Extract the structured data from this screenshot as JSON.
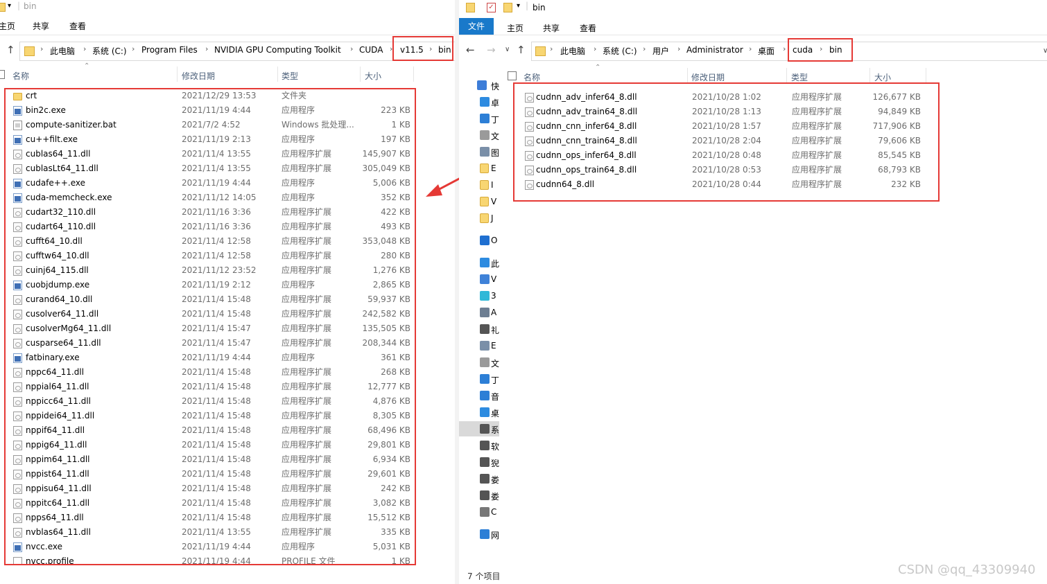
{
  "left": {
    "title": "bin",
    "ribbon": [
      "主页",
      "共享",
      "查看"
    ],
    "breadcrumb": [
      "此电脑",
      "系统 (C:)",
      "Program Files",
      "NVIDIA GPU Computing Toolkit",
      "CUDA",
      "v11.5",
      "bin"
    ],
    "columns": {
      "name": "名称",
      "date": "修改日期",
      "type": "类型",
      "size": "大小"
    },
    "files": [
      {
        "name": "crt",
        "date": "2021/12/29 13:53",
        "type": "文件夹",
        "size": "",
        "icon": "folder-icon"
      },
      {
        "name": "bin2c.exe",
        "date": "2021/11/19 4:44",
        "type": "应用程序",
        "size": "223 KB",
        "icon": "exe-icon"
      },
      {
        "name": "compute-sanitizer.bat",
        "date": "2021/7/2 4:52",
        "type": "Windows 批处理...",
        "size": "1 KB",
        "icon": "bat-icon"
      },
      {
        "name": "cu++filt.exe",
        "date": "2021/11/19 2:13",
        "type": "应用程序",
        "size": "197 KB",
        "icon": "exe-icon"
      },
      {
        "name": "cublas64_11.dll",
        "date": "2021/11/4 13:55",
        "type": "应用程序扩展",
        "size": "145,907 KB",
        "icon": "dll-icon"
      },
      {
        "name": "cublasLt64_11.dll",
        "date": "2021/11/4 13:55",
        "type": "应用程序扩展",
        "size": "305,049 KB",
        "icon": "dll-icon"
      },
      {
        "name": "cudafe++.exe",
        "date": "2021/11/19 4:44",
        "type": "应用程序",
        "size": "5,006 KB",
        "icon": "exe-icon"
      },
      {
        "name": "cuda-memcheck.exe",
        "date": "2021/11/12 14:05",
        "type": "应用程序",
        "size": "352 KB",
        "icon": "exe-icon"
      },
      {
        "name": "cudart32_110.dll",
        "date": "2021/11/16 3:36",
        "type": "应用程序扩展",
        "size": "422 KB",
        "icon": "dll-icon"
      },
      {
        "name": "cudart64_110.dll",
        "date": "2021/11/16 3:36",
        "type": "应用程序扩展",
        "size": "493 KB",
        "icon": "dll-icon"
      },
      {
        "name": "cufft64_10.dll",
        "date": "2021/11/4 12:58",
        "type": "应用程序扩展",
        "size": "353,048 KB",
        "icon": "dll-icon"
      },
      {
        "name": "cufftw64_10.dll",
        "date": "2021/11/4 12:58",
        "type": "应用程序扩展",
        "size": "280 KB",
        "icon": "dll-icon"
      },
      {
        "name": "cuinj64_115.dll",
        "date": "2021/11/12 23:52",
        "type": "应用程序扩展",
        "size": "1,276 KB",
        "icon": "dll-icon"
      },
      {
        "name": "cuobjdump.exe",
        "date": "2021/11/19 2:12",
        "type": "应用程序",
        "size": "2,865 KB",
        "icon": "exe-icon"
      },
      {
        "name": "curand64_10.dll",
        "date": "2021/11/4 15:48",
        "type": "应用程序扩展",
        "size": "59,937 KB",
        "icon": "dll-icon"
      },
      {
        "name": "cusolver64_11.dll",
        "date": "2021/11/4 15:48",
        "type": "应用程序扩展",
        "size": "242,582 KB",
        "icon": "dll-icon"
      },
      {
        "name": "cusolverMg64_11.dll",
        "date": "2021/11/4 15:47",
        "type": "应用程序扩展",
        "size": "135,505 KB",
        "icon": "dll-icon"
      },
      {
        "name": "cusparse64_11.dll",
        "date": "2021/11/4 15:47",
        "type": "应用程序扩展",
        "size": "208,344 KB",
        "icon": "dll-icon"
      },
      {
        "name": "fatbinary.exe",
        "date": "2021/11/19 4:44",
        "type": "应用程序",
        "size": "361 KB",
        "icon": "exe-icon"
      },
      {
        "name": "nppc64_11.dll",
        "date": "2021/11/4 15:48",
        "type": "应用程序扩展",
        "size": "268 KB",
        "icon": "dll-icon"
      },
      {
        "name": "nppial64_11.dll",
        "date": "2021/11/4 15:48",
        "type": "应用程序扩展",
        "size": "12,777 KB",
        "icon": "dll-icon"
      },
      {
        "name": "nppicc64_11.dll",
        "date": "2021/11/4 15:48",
        "type": "应用程序扩展",
        "size": "4,876 KB",
        "icon": "dll-icon"
      },
      {
        "name": "nppidei64_11.dll",
        "date": "2021/11/4 15:48",
        "type": "应用程序扩展",
        "size": "8,305 KB",
        "icon": "dll-icon"
      },
      {
        "name": "nppif64_11.dll",
        "date": "2021/11/4 15:48",
        "type": "应用程序扩展",
        "size": "68,496 KB",
        "icon": "dll-icon"
      },
      {
        "name": "nppig64_11.dll",
        "date": "2021/11/4 15:48",
        "type": "应用程序扩展",
        "size": "29,801 KB",
        "icon": "dll-icon"
      },
      {
        "name": "nppim64_11.dll",
        "date": "2021/11/4 15:48",
        "type": "应用程序扩展",
        "size": "6,934 KB",
        "icon": "dll-icon"
      },
      {
        "name": "nppist64_11.dll",
        "date": "2021/11/4 15:48",
        "type": "应用程序扩展",
        "size": "29,601 KB",
        "icon": "dll-icon"
      },
      {
        "name": "nppisu64_11.dll",
        "date": "2021/11/4 15:48",
        "type": "应用程序扩展",
        "size": "242 KB",
        "icon": "dll-icon"
      },
      {
        "name": "nppitc64_11.dll",
        "date": "2021/11/4 15:48",
        "type": "应用程序扩展",
        "size": "3,082 KB",
        "icon": "dll-icon"
      },
      {
        "name": "npps64_11.dll",
        "date": "2021/11/4 15:48",
        "type": "应用程序扩展",
        "size": "15,512 KB",
        "icon": "dll-icon"
      },
      {
        "name": "nvblas64_11.dll",
        "date": "2021/11/4 13:55",
        "type": "应用程序扩展",
        "size": "335 KB",
        "icon": "dll-icon"
      },
      {
        "name": "nvcc.exe",
        "date": "2021/11/19 4:44",
        "type": "应用程序",
        "size": "5,031 KB",
        "icon": "exe-icon"
      },
      {
        "name": "nvcc.profile",
        "date": "2021/11/19 4:44",
        "type": "PROFILE 文件",
        "size": "1 KB",
        "icon": "file-icon"
      }
    ]
  },
  "right": {
    "title": "bin",
    "ribbon": {
      "file": "文件",
      "home": "主页",
      "share": "共享",
      "view": "查看"
    },
    "breadcrumb": [
      "此电脑",
      "系统 (C:)",
      "用户",
      "Administrator",
      "桌面",
      "cuda",
      "bin"
    ],
    "columns": {
      "name": "名称",
      "date": "修改日期",
      "type": "类型",
      "size": "大小"
    },
    "files": [
      {
        "name": "cudnn_adv_infer64_8.dll",
        "date": "2021/10/28 1:02",
        "type": "应用程序扩展",
        "size": "126,677 KB"
      },
      {
        "name": "cudnn_adv_train64_8.dll",
        "date": "2021/10/28 1:13",
        "type": "应用程序扩展",
        "size": "94,849 KB"
      },
      {
        "name": "cudnn_cnn_infer64_8.dll",
        "date": "2021/10/28 1:57",
        "type": "应用程序扩展",
        "size": "717,906 KB"
      },
      {
        "name": "cudnn_cnn_train64_8.dll",
        "date": "2021/10/28 2:04",
        "type": "应用程序扩展",
        "size": "79,606 KB"
      },
      {
        "name": "cudnn_ops_infer64_8.dll",
        "date": "2021/10/28 0:48",
        "type": "应用程序扩展",
        "size": "85,545 KB"
      },
      {
        "name": "cudnn_ops_train64_8.dll",
        "date": "2021/10/28 0:53",
        "type": "应用程序扩展",
        "size": "68,793 KB"
      },
      {
        "name": "cudnn64_8.dll",
        "date": "2021/10/28 0:44",
        "type": "应用程序扩展",
        "size": "232 KB"
      }
    ],
    "nav_pane": [
      {
        "icon": "star-icon",
        "text": "快",
        "color": "#3d7dd8"
      },
      {
        "icon": "desktop-icon",
        "text": "卓",
        "color": "#2d8be0"
      },
      {
        "icon": "download-icon",
        "text": "丁",
        "color": "#2d7fd6"
      },
      {
        "icon": "document-icon",
        "text": "文",
        "color": "#9a9a9a"
      },
      {
        "icon": "picture-icon",
        "text": "图",
        "color": "#7a8fa8"
      },
      {
        "icon": "folder-icon",
        "text": "E",
        "color": "#f8d672"
      },
      {
        "icon": "folder-icon",
        "text": "I",
        "color": "#f8d672"
      },
      {
        "icon": "folder-icon",
        "text": "V",
        "color": "#f8d672"
      },
      {
        "icon": "folder-icon",
        "text": "J",
        "color": "#f8d672"
      },
      {
        "icon": "onedrive-icon",
        "text": "O",
        "color": "#1f6fd0"
      },
      {
        "icon": "this-pc-icon",
        "text": "此",
        "color": "#2d8be0"
      },
      {
        "icon": "cloud-icon",
        "text": "V",
        "color": "#3f82d8"
      },
      {
        "icon": "3d-objects-icon",
        "text": "3",
        "color": "#2fb8d8"
      },
      {
        "icon": "video-icon",
        "text": "A",
        "color": "#6d7e92"
      },
      {
        "icon": "film-icon",
        "text": "礼",
        "color": "#555"
      },
      {
        "icon": "picture-icon",
        "text": "E",
        "color": "#7a8fa8"
      },
      {
        "icon": "document-icon",
        "text": "文",
        "color": "#9a9a9a"
      },
      {
        "icon": "download-icon",
        "text": "丁",
        "color": "#2d7fd6"
      },
      {
        "icon": "music-icon",
        "text": "音",
        "color": "#2d7fd6"
      },
      {
        "icon": "desktop-icon",
        "text": "桌",
        "color": "#2d8be0"
      },
      {
        "icon": "drive-c-icon",
        "text": "系",
        "color": "#555"
      },
      {
        "icon": "drive-icon",
        "text": "软",
        "color": "#555"
      },
      {
        "icon": "drive-icon",
        "text": "猊",
        "color": "#555"
      },
      {
        "icon": "drive-icon",
        "text": "娄",
        "color": "#555"
      },
      {
        "icon": "drive-icon",
        "text": "娄",
        "color": "#555"
      },
      {
        "icon": "cd-drive-icon",
        "text": "C",
        "color": "#777"
      },
      {
        "icon": "network-icon",
        "text": "网",
        "color": "#2d7fd6"
      }
    ],
    "status": "7 个项目"
  },
  "watermark": "CSDN @qq_43309940",
  "colors": {
    "accent": "#1979ca",
    "highlight": "#e53935",
    "selected_nav": "#d9d9d9"
  }
}
